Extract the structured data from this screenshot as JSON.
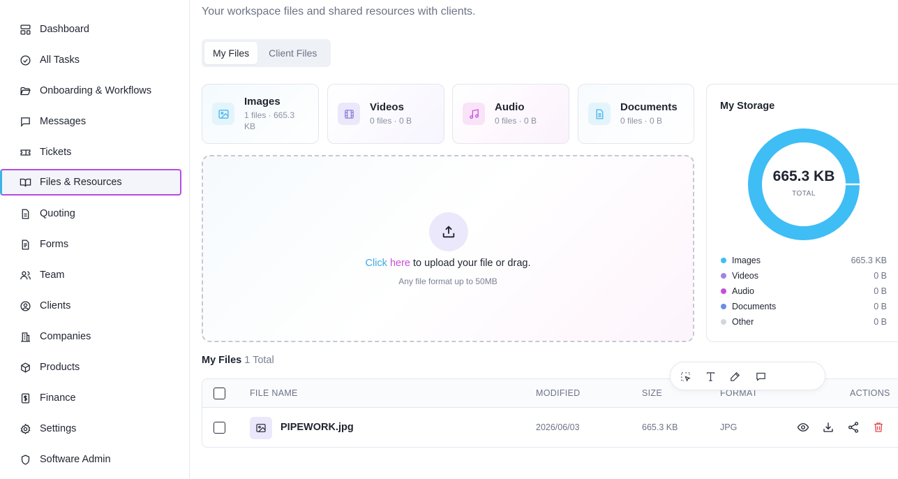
{
  "sidebar": {
    "items": [
      {
        "label": "Dashboard",
        "icon": "dashboard-icon"
      },
      {
        "label": "All Tasks",
        "icon": "check-circle-icon"
      },
      {
        "label": "Onboarding & Workflows",
        "icon": "folder-open-icon"
      },
      {
        "label": "Messages",
        "icon": "message-icon"
      },
      {
        "label": "Tickets",
        "icon": "ticket-icon"
      },
      {
        "label": "Files & Resources",
        "icon": "book-open-icon",
        "active": true
      },
      {
        "label": "Quoting",
        "icon": "document-icon"
      },
      {
        "label": "Forms",
        "icon": "form-icon"
      },
      {
        "label": "Team",
        "icon": "users-icon"
      },
      {
        "label": "Clients",
        "icon": "user-circle-icon"
      },
      {
        "label": "Companies",
        "icon": "building-icon"
      },
      {
        "label": "Products",
        "icon": "package-icon"
      },
      {
        "label": "Finance",
        "icon": "dollar-icon"
      },
      {
        "label": "Settings",
        "icon": "gear-icon"
      },
      {
        "label": "Software Admin",
        "icon": "shield-icon"
      }
    ]
  },
  "header": {
    "subtitle": "Your workspace files and shared resources with clients."
  },
  "tabs": [
    {
      "label": "My Files",
      "active": true
    },
    {
      "label": "Client Files",
      "active": false
    }
  ],
  "categories": [
    {
      "title": "Images",
      "sub": "1 files · 665.3 KB",
      "icon": "image-icon",
      "color": "#3fb3e8"
    },
    {
      "title": "Videos",
      "sub": "0 files · 0 B",
      "icon": "film-icon",
      "color": "#8b7fd8"
    },
    {
      "title": "Audio",
      "sub": "0 files · 0 B",
      "icon": "music-icon",
      "color": "#c54fd8"
    },
    {
      "title": "Documents",
      "sub": "0 files · 0 B",
      "icon": "document-icon",
      "color": "#3fb3e8"
    }
  ],
  "upload": {
    "link_text_1": "Click ",
    "link_text_2": "here",
    "rest_text": " to upload your file or drag.",
    "hint": "Any file format up to 50MB"
  },
  "storage": {
    "title": "My Storage",
    "total_value": "665.3 KB",
    "total_label": "TOTAL",
    "legend": [
      {
        "name": "Images",
        "value": "665.3 KB",
        "color": "#3fbdf5"
      },
      {
        "name": "Videos",
        "value": "0 B",
        "color": "#9d86e0"
      },
      {
        "name": "Audio",
        "value": "0 B",
        "color": "#c74fdc"
      },
      {
        "name": "Documents",
        "value": "0 B",
        "color": "#6a8be8"
      },
      {
        "name": "Other",
        "value": "0 B",
        "color": "#d2d6de"
      }
    ]
  },
  "files": {
    "heading": "My Files",
    "count": "1 Total",
    "columns": {
      "name": "FILE NAME",
      "modified": "MODIFIED",
      "size": "SIZE",
      "format": "FORMAT",
      "actions": "ACTIONS"
    },
    "rows": [
      {
        "name": "PIPEWORK.jpg",
        "modified": "2026/06/03",
        "size": "665.3 KB",
        "format": "JPG"
      }
    ]
  },
  "colors": {
    "accent_blue": "#3fb3e8",
    "accent_pink": "#c54fd8",
    "delete_red": "#e5484d"
  }
}
